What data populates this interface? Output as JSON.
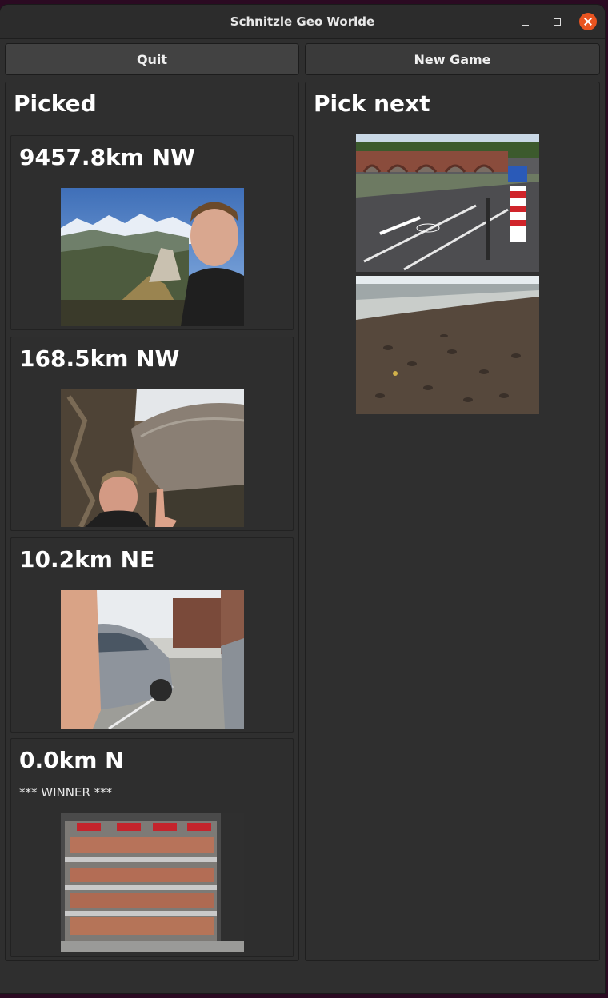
{
  "window": {
    "title": "Schnitzle Geo Worlde"
  },
  "toolbar": {
    "quit_label": "Quit",
    "new_game_label": "New Game"
  },
  "picked": {
    "heading": "Picked",
    "items": [
      {
        "distance": "9457.8km NW",
        "winner": ""
      },
      {
        "distance": "168.5km NW",
        "winner": ""
      },
      {
        "distance": "10.2km NE",
        "winner": ""
      },
      {
        "distance": "0.0km N",
        "winner": "*** WINNER ***"
      }
    ]
  },
  "pick_next": {
    "heading": "Pick next"
  },
  "colors": {
    "close_button": "#e95420",
    "background": "#2f2f2f",
    "text": "#ffffff"
  }
}
